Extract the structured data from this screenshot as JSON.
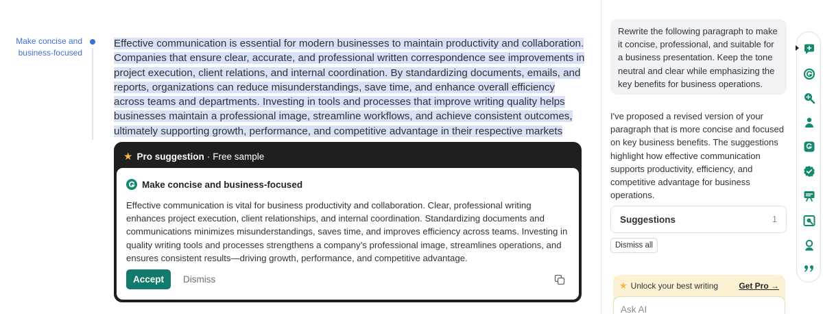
{
  "annotation": {
    "label": "Make concise and business-focused"
  },
  "document": {
    "paragraph": "Effective communication is essential for modern businesses to maintain productivity and collaboration. Companies that ensure clear, accurate, and professional written correspondence see improvements in project execution, client relations, and internal coordination. By standardizing documents, emails, and reports, organizations can reduce misunderstandings, save time, and enhance overall efficiency across teams and departments. Investing in tools and processes that improve writing quality helps businesses maintain a professional image, streamline workflows, and achieve consistent outcomes, ultimately supporting growth, performance, and competitive advantage in their respective markets"
  },
  "suggestion_card": {
    "header_pro": "Pro suggestion",
    "header_separator": "·",
    "header_sample": "Free sample",
    "title": "Make concise and business-focused",
    "body": "Effective communication is vital for business productivity and collaboration. Clear, professional writing enhances project execution, client relationships, and internal coordination. Standardizing documents and communications minimizes misunderstandings, saves time, and improves efficiency across teams. Investing in quality writing tools and processes strengthens a company’s professional image, streamlines operations, and ensures consistent results—driving growth, performance, and competitive advantage.",
    "accept_label": "Accept",
    "dismiss_label": "Dismiss"
  },
  "panel": {
    "prompt": "Rewrite the following paragraph to make it concise, professional, and suitable for a business presentation. Keep the tone neutral and clear while emphasizing the key benefits for business operations.",
    "reply": "I've proposed a revised version of your paragraph that is more concise and focused on key business benefits. The suggestions highlight how effective communication supports productivity, efficiency, and competitive advantage for business operations.",
    "suggestions_label": "Suggestions",
    "suggestions_count": "1",
    "dismiss_all_label": "Dismiss all",
    "unlock_label": "Unlock your best writing",
    "get_pro_label": "Get Pro →",
    "ask_ai_placeholder": "Ask AI"
  },
  "rail": {
    "icons": [
      "chat-plus-icon",
      "grammarly-g-icon",
      "search-zoom-icon",
      "person-icon",
      "rewrite-icon",
      "verified-check-icon",
      "presentation-icon",
      "plagiarism-icon",
      "user-badge-icon",
      "quote-icon"
    ]
  },
  "colors": {
    "accent_blue": "#3f6fd8",
    "highlight": "#d9e1f7",
    "accept_green": "#127a6a",
    "rail_green": "#13896f",
    "card_dark": "#1f1f1f",
    "pro_yellow": "#fdf1d3",
    "star": "#f6b73c"
  }
}
